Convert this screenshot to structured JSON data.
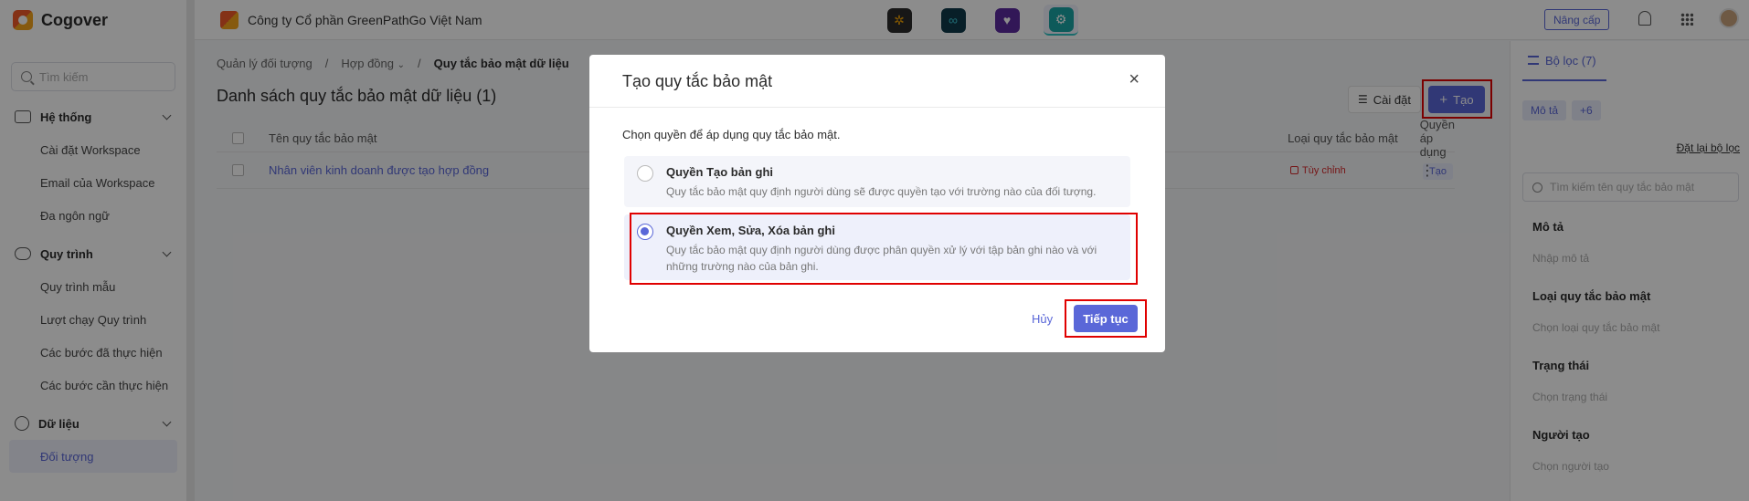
{
  "app": {
    "brand": "Cogover",
    "company": "Công ty Cổ phần GreenPathGo Việt Nam",
    "accent": "#5a67d8"
  },
  "sidebar": {
    "search_placeholder": "Tìm kiếm",
    "groups": [
      {
        "label": "Hệ thống",
        "items": [
          "Cài đặt Workspace",
          "Email của Workspace",
          "Đa ngôn ngữ"
        ]
      },
      {
        "label": "Quy trình",
        "items": [
          "Quy trình mẫu",
          "Lượt chạy Quy trình",
          "Các bước đã thực hiện",
          "Các bước cần thực hiện"
        ]
      },
      {
        "label": "Dữ liệu",
        "items": [
          "Đối tượng"
        ]
      }
    ]
  },
  "topbar": {
    "upgrade": "Nâng cấp"
  },
  "page": {
    "breadcrumb": [
      "Quản lý đối tượng",
      "/",
      "Hợp đồng",
      "/",
      "Quy tắc bảo mật dữ liệu"
    ],
    "title": "Danh sách quy tắc bảo mật dữ liệu (1)",
    "settings_label": "Cài đặt",
    "create_label": "Tạo",
    "columns": {
      "name": "Tên quy tắc bảo mật",
      "type": "Loại quy tắc bảo mật",
      "perm": "Quyền áp dụng"
    },
    "rows": [
      {
        "name": "Nhân viên kinh doanh được tạo hợp đồng",
        "type": "Tùy chỉnh",
        "perm": "Tạo"
      }
    ]
  },
  "filter": {
    "tab": "Bộ lọc (7)",
    "chips": [
      "Mô tả",
      "+6"
    ],
    "reset": "Đặt lại bộ lọc",
    "search_placeholder": "Tìm kiếm tên quy tắc bảo mật",
    "fields": [
      {
        "label": "Mô tả",
        "placeholder": "Nhập mô tả"
      },
      {
        "label": "Loại quy tắc bảo mật",
        "placeholder": "Chọn loại quy tắc bảo mật"
      },
      {
        "label": "Trạng thái",
        "placeholder": "Chọn trạng thái"
      },
      {
        "label": "Người tạo",
        "placeholder": "Chọn người tạo"
      }
    ]
  },
  "modal": {
    "title": "Tạo quy tắc bảo mật",
    "subtitle": "Chọn quyền để áp dụng quy tắc bảo mật.",
    "options": [
      {
        "title": "Quyền Tạo bản ghi",
        "desc": "Quy tắc bảo mật quy định người dùng sẽ được quyền tạo với trường nào của đối tượng.",
        "selected": false
      },
      {
        "title": "Quyền Xem, Sửa, Xóa bản ghi",
        "desc": "Quy tắc bảo mật quy định người dùng được phân quyền xử lý với tập bản ghi nào và với những trường nào của bản ghi.",
        "selected": true
      }
    ],
    "cancel": "Hủy",
    "next": "Tiếp tục"
  }
}
